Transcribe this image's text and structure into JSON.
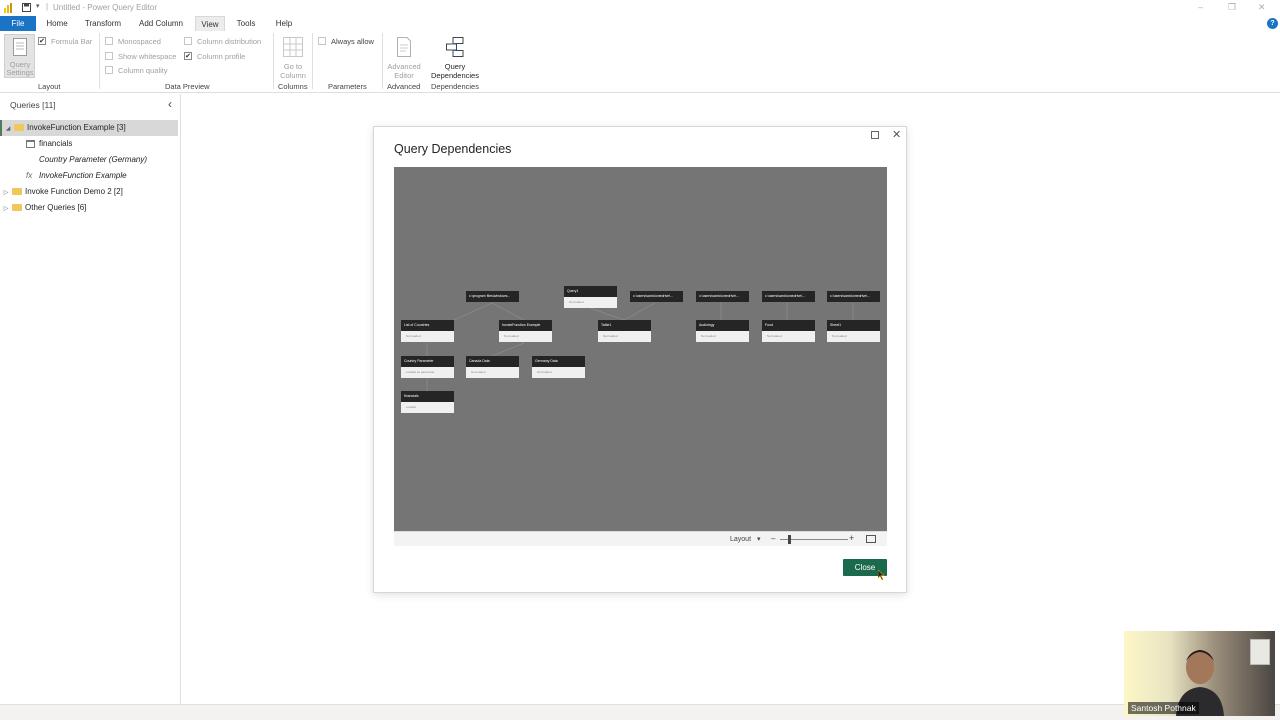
{
  "window": {
    "title": "Untitled - Power Query Editor",
    "controls": [
      "–",
      "❐",
      "✕"
    ]
  },
  "menu": {
    "items": [
      "File",
      "Home",
      "Transform",
      "Add Column",
      "View",
      "Tools",
      "Help"
    ],
    "active": "View",
    "help_icon": "?"
  },
  "ribbon": {
    "query_settings": "Query Settings",
    "formula_bar": "Formula Bar",
    "layout_group": "Layout",
    "monospaced": "Monospaced",
    "show_whitespace": "Show whitespace",
    "column_quality": "Column quality",
    "column_distribution": "Column distribution",
    "column_profile": "Column profile",
    "data_preview_group": "Data Preview",
    "go_to_column": "Go to Column",
    "columns_group": "Columns",
    "always_allow": "Always allow",
    "parameters_group": "Parameters",
    "advanced_editor": "Advanced Editor",
    "advanced_group": "Advanced",
    "query_dependencies": "Query Dependencies",
    "dependencies_group": "Dependencies"
  },
  "queries": {
    "header": "Queries [11]",
    "collapse_icon": "‹",
    "items": [
      {
        "label": "InvokeFunction Example [3]",
        "kind": "folder"
      },
      {
        "label": "financials",
        "kind": "table"
      },
      {
        "label": "Country Parameter (Germany)",
        "kind": "param"
      },
      {
        "label": "InvokeFunction Example",
        "kind": "function"
      },
      {
        "label": "Invoke Function Demo 2 [2]",
        "kind": "folder"
      },
      {
        "label": "Other Queries [6]",
        "kind": "folder"
      }
    ]
  },
  "dialog": {
    "title": "Query Dependencies",
    "layout_label": "Layout",
    "close_button": "Close",
    "nodes": [
      {
        "id": "n1",
        "head": "c:\\program files\\windows...",
        "body": ""
      },
      {
        "id": "n2",
        "head": "Query1",
        "body": "Not loaded"
      },
      {
        "id": "n3",
        "head": "c:\\users\\santo\\onedrive\\...",
        "body": ""
      },
      {
        "id": "n4",
        "head": "c:\\users\\santo\\onedrive\\...",
        "body": ""
      },
      {
        "id": "n5",
        "head": "c:\\users\\santo\\onedrive\\...",
        "body": ""
      },
      {
        "id": "n6",
        "head": "c:\\users\\santo\\onedrive\\...",
        "body": ""
      },
      {
        "id": "n7",
        "head": "List of Countries",
        "body": "Not loaded"
      },
      {
        "id": "n8",
        "head": "InvokeFunction Example",
        "body": "Not loaded"
      },
      {
        "id": "n9",
        "head": "Table1",
        "body": "Not loaded"
      },
      {
        "id": "n10",
        "head": "Audiology",
        "body": "Not loaded"
      },
      {
        "id": "n11",
        "head": "Food",
        "body": "Not loaded"
      },
      {
        "id": "n12",
        "head": "Sheet1",
        "body": "Not loaded"
      },
      {
        "id": "n13",
        "head": "Country Parameter",
        "body": "Loaded as parameter"
      },
      {
        "id": "n14",
        "head": "Canada Data",
        "body": "Not loaded"
      },
      {
        "id": "n15",
        "head": "Germany Data",
        "body": "Not loaded"
      },
      {
        "id": "n16",
        "head": "financials",
        "body": "Loaded"
      }
    ]
  },
  "webcam": {
    "name": "Santosh Pothnak"
  }
}
